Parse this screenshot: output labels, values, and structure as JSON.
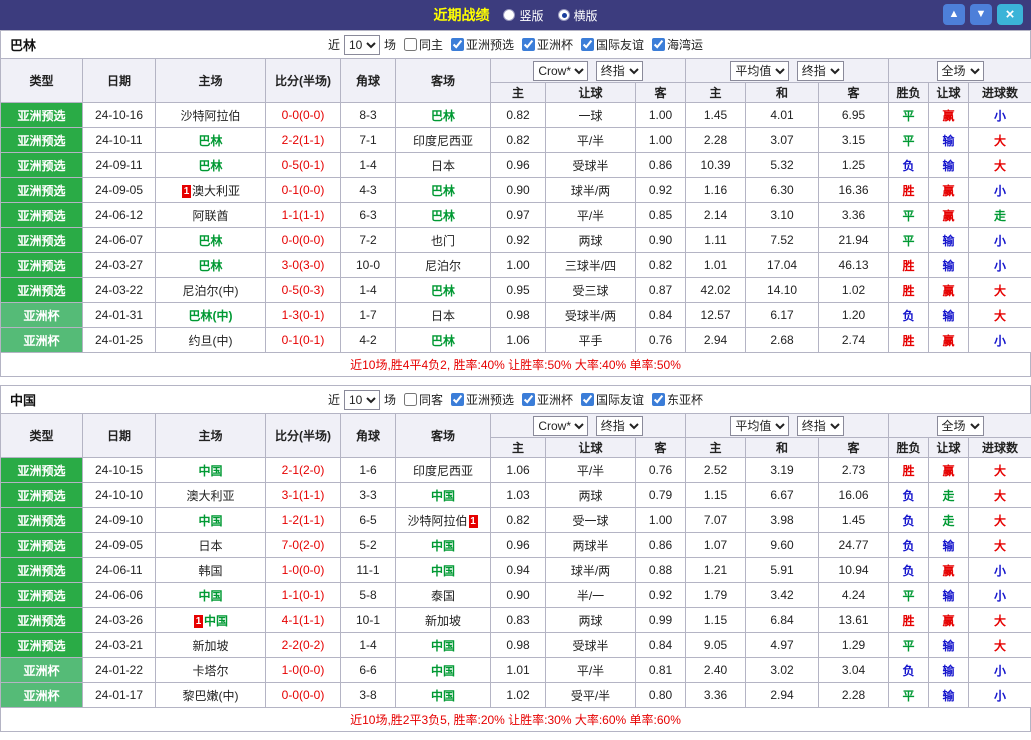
{
  "palette": {
    "titlebar_bg": "#3c3c7e",
    "title_color": "#ffff00",
    "scroll_btn": "#4d7fd9",
    "close_btn": "#3bb4d8",
    "red": "#e60000",
    "blue": "#1414cc",
    "green": "#009933",
    "type_pre": "#2aab46",
    "type_cup": "#55bb77",
    "header_bg": "#f0f0f7",
    "odds_col_bg": "#fdf5f0",
    "border": "#b4b4c4"
  },
  "titlebar": {
    "title": "近期战绩",
    "radios": [
      {
        "label": "竖版",
        "selected": false
      },
      {
        "label": "横版",
        "selected": true
      }
    ],
    "up_icon": "▲",
    "down_icon": "▼",
    "close_icon": "×"
  },
  "table_header": {
    "cols": [
      "类型",
      "日期",
      "主场",
      "比分(半场)",
      "角球",
      "客场"
    ],
    "dropdown_odds_source": "Crow*",
    "dropdown_odds_time": "终指",
    "dropdown_avg_source": "平均值",
    "dropdown_avg_time": "终指",
    "dropdown_scope": "全场",
    "odds_subcols": [
      "主",
      "让球",
      "客"
    ],
    "avg_subcols": [
      "主",
      "和",
      "客"
    ],
    "result_subcols": [
      "胜负",
      "让球",
      "进球数"
    ]
  },
  "sections": [
    {
      "team": "巴林",
      "filter": {
        "prefix": "近",
        "count": "10",
        "suffix": "场",
        "same_side": {
          "label": "同主",
          "checked": false
        },
        "competitions": [
          {
            "label": "亚洲预选",
            "checked": true
          },
          {
            "label": "亚洲杯",
            "checked": true
          },
          {
            "label": "国际友谊",
            "checked": true
          },
          {
            "label": "海湾运",
            "checked": true
          }
        ]
      },
      "rows": [
        {
          "type": "亚洲预选",
          "date": "24-10-16",
          "home": {
            "name": "沙特阿拉伯",
            "green": false
          },
          "score": "0-0(0-0)",
          "corners": "8-3",
          "away": {
            "name": "巴林",
            "green": true
          },
          "odds": [
            "0.82",
            "一球",
            "1.00"
          ],
          "avg": [
            "1.45",
            "4.01",
            "6.95"
          ],
          "result": {
            "text": "平",
            "color": "green"
          },
          "let": {
            "text": "赢",
            "color": "red"
          },
          "goals": {
            "text": "小",
            "color": "blue"
          }
        },
        {
          "type": "亚洲预选",
          "date": "24-10-11",
          "home": {
            "name": "巴林",
            "green": true
          },
          "score": "2-2(1-1)",
          "corners": "7-1",
          "away": {
            "name": "印度尼西亚",
            "green": false
          },
          "odds": [
            "0.82",
            "平/半",
            "1.00"
          ],
          "avg": [
            "2.28",
            "3.07",
            "3.15"
          ],
          "result": {
            "text": "平",
            "color": "green"
          },
          "let": {
            "text": "输",
            "color": "blue"
          },
          "goals": {
            "text": "大",
            "color": "red"
          }
        },
        {
          "type": "亚洲预选",
          "date": "24-09-11",
          "home": {
            "name": "巴林",
            "green": true
          },
          "score": "0-5(0-1)",
          "corners": "1-4",
          "away": {
            "name": "日本",
            "green": false
          },
          "odds": [
            "0.96",
            "受球半",
            "0.86"
          ],
          "avg": [
            "10.39",
            "5.32",
            "1.25"
          ],
          "result": {
            "text": "负",
            "color": "blue"
          },
          "let": {
            "text": "输",
            "color": "blue"
          },
          "goals": {
            "text": "大",
            "color": "red"
          }
        },
        {
          "type": "亚洲预选",
          "date": "24-09-05",
          "home": {
            "name": "澳大利亚",
            "green": false,
            "red_card": "1",
            "red_card_pos": "before"
          },
          "score": "0-1(0-0)",
          "corners": "4-3",
          "away": {
            "name": "巴林",
            "green": true
          },
          "odds": [
            "0.90",
            "球半/两",
            "0.92"
          ],
          "avg": [
            "1.16",
            "6.30",
            "16.36"
          ],
          "result": {
            "text": "胜",
            "color": "red"
          },
          "let": {
            "text": "赢",
            "color": "red"
          },
          "goals": {
            "text": "小",
            "color": "blue"
          }
        },
        {
          "type": "亚洲预选",
          "date": "24-06-12",
          "home": {
            "name": "阿联酋",
            "green": false
          },
          "score": "1-1(1-1)",
          "corners": "6-3",
          "away": {
            "name": "巴林",
            "green": true
          },
          "odds": [
            "0.97",
            "平/半",
            "0.85"
          ],
          "avg": [
            "2.14",
            "3.10",
            "3.36"
          ],
          "result": {
            "text": "平",
            "color": "green"
          },
          "let": {
            "text": "赢",
            "color": "red"
          },
          "goals": {
            "text": "走",
            "color": "green"
          }
        },
        {
          "type": "亚洲预选",
          "date": "24-06-07",
          "home": {
            "name": "巴林",
            "green": true
          },
          "score": "0-0(0-0)",
          "corners": "7-2",
          "away": {
            "name": "也门",
            "green": false
          },
          "odds": [
            "0.92",
            "两球",
            "0.90"
          ],
          "avg": [
            "1.11",
            "7.52",
            "21.94"
          ],
          "result": {
            "text": "平",
            "color": "green"
          },
          "let": {
            "text": "输",
            "color": "blue"
          },
          "goals": {
            "text": "小",
            "color": "blue"
          }
        },
        {
          "type": "亚洲预选",
          "date": "24-03-27",
          "home": {
            "name": "巴林",
            "green": true
          },
          "score": "3-0(3-0)",
          "corners": "10-0",
          "away": {
            "name": "尼泊尔",
            "green": false
          },
          "odds": [
            "1.00",
            "三球半/四",
            "0.82"
          ],
          "avg": [
            "1.01",
            "17.04",
            "46.13"
          ],
          "result": {
            "text": "胜",
            "color": "red"
          },
          "let": {
            "text": "输",
            "color": "blue"
          },
          "goals": {
            "text": "小",
            "color": "blue"
          }
        },
        {
          "type": "亚洲预选",
          "date": "24-03-22",
          "home": {
            "name": "尼泊尔(中)",
            "green": false
          },
          "score": "0-5(0-3)",
          "corners": "1-4",
          "away": {
            "name": "巴林",
            "green": true
          },
          "odds": [
            "0.95",
            "受三球",
            "0.87"
          ],
          "avg": [
            "42.02",
            "14.10",
            "1.02"
          ],
          "result": {
            "text": "胜",
            "color": "red"
          },
          "let": {
            "text": "赢",
            "color": "red"
          },
          "goals": {
            "text": "大",
            "color": "red"
          }
        },
        {
          "type": "亚洲杯",
          "date": "24-01-31",
          "home": {
            "name": "巴林(中)",
            "green": true
          },
          "score": "1-3(0-1)",
          "corners": "1-7",
          "away": {
            "name": "日本",
            "green": false
          },
          "odds": [
            "0.98",
            "受球半/两",
            "0.84"
          ],
          "avg": [
            "12.57",
            "6.17",
            "1.20"
          ],
          "result": {
            "text": "负",
            "color": "blue"
          },
          "let": {
            "text": "输",
            "color": "blue"
          },
          "goals": {
            "text": "大",
            "color": "red"
          }
        },
        {
          "type": "亚洲杯",
          "date": "24-01-25",
          "home": {
            "name": "约旦(中)",
            "green": false
          },
          "score": "0-1(0-1)",
          "corners": "4-2",
          "away": {
            "name": "巴林",
            "green": true
          },
          "odds": [
            "1.06",
            "平手",
            "0.76"
          ],
          "avg": [
            "2.94",
            "2.68",
            "2.74"
          ],
          "result": {
            "text": "胜",
            "color": "red"
          },
          "let": {
            "text": "赢",
            "color": "red"
          },
          "goals": {
            "text": "小",
            "color": "blue"
          }
        }
      ],
      "summary": "近10场,胜4平4负2, 胜率:40% 让胜率:50% 大率:40% 单率:50%"
    },
    {
      "team": "中国",
      "filter": {
        "prefix": "近",
        "count": "10",
        "suffix": "场",
        "same_side": {
          "label": "同客",
          "checked": false
        },
        "competitions": [
          {
            "label": "亚洲预选",
            "checked": true
          },
          {
            "label": "亚洲杯",
            "checked": true
          },
          {
            "label": "国际友谊",
            "checked": true
          },
          {
            "label": "东亚杯",
            "checked": true
          }
        ]
      },
      "rows": [
        {
          "type": "亚洲预选",
          "date": "24-10-15",
          "home": {
            "name": "中国",
            "green": true
          },
          "score": "2-1(2-0)",
          "corners": "1-6",
          "away": {
            "name": "印度尼西亚",
            "green": false
          },
          "odds": [
            "1.06",
            "平/半",
            "0.76"
          ],
          "avg": [
            "2.52",
            "3.19",
            "2.73"
          ],
          "result": {
            "text": "胜",
            "color": "red"
          },
          "let": {
            "text": "赢",
            "color": "red"
          },
          "goals": {
            "text": "大",
            "color": "red"
          }
        },
        {
          "type": "亚洲预选",
          "date": "24-10-10",
          "home": {
            "name": "澳大利亚",
            "green": false
          },
          "score": "3-1(1-1)",
          "corners": "3-3",
          "away": {
            "name": "中国",
            "green": true
          },
          "odds": [
            "1.03",
            "两球",
            "0.79"
          ],
          "avg": [
            "1.15",
            "6.67",
            "16.06"
          ],
          "result": {
            "text": "负",
            "color": "blue"
          },
          "let": {
            "text": "走",
            "color": "green"
          },
          "goals": {
            "text": "大",
            "color": "red"
          }
        },
        {
          "type": "亚洲预选",
          "date": "24-09-10",
          "home": {
            "name": "中国",
            "green": true
          },
          "score": "1-2(1-1)",
          "corners": "6-5",
          "away": {
            "name": "沙特阿拉伯",
            "green": false,
            "red_card": "1",
            "red_card_pos": "after"
          },
          "odds": [
            "0.82",
            "受一球",
            "1.00"
          ],
          "avg": [
            "7.07",
            "3.98",
            "1.45"
          ],
          "result": {
            "text": "负",
            "color": "blue"
          },
          "let": {
            "text": "走",
            "color": "green"
          },
          "goals": {
            "text": "大",
            "color": "red"
          }
        },
        {
          "type": "亚洲预选",
          "date": "24-09-05",
          "home": {
            "name": "日本",
            "green": false
          },
          "score": "7-0(2-0)",
          "corners": "5-2",
          "away": {
            "name": "中国",
            "green": true
          },
          "odds": [
            "0.96",
            "两球半",
            "0.86"
          ],
          "avg": [
            "1.07",
            "9.60",
            "24.77"
          ],
          "result": {
            "text": "负",
            "color": "blue"
          },
          "let": {
            "text": "输",
            "color": "blue"
          },
          "goals": {
            "text": "大",
            "color": "red"
          }
        },
        {
          "type": "亚洲预选",
          "date": "24-06-11",
          "home": {
            "name": "韩国",
            "green": false
          },
          "score": "1-0(0-0)",
          "corners": "11-1",
          "away": {
            "name": "中国",
            "green": true
          },
          "odds": [
            "0.94",
            "球半/两",
            "0.88"
          ],
          "avg": [
            "1.21",
            "5.91",
            "10.94"
          ],
          "result": {
            "text": "负",
            "color": "blue"
          },
          "let": {
            "text": "赢",
            "color": "red"
          },
          "goals": {
            "text": "小",
            "color": "blue"
          }
        },
        {
          "type": "亚洲预选",
          "date": "24-06-06",
          "home": {
            "name": "中国",
            "green": true
          },
          "score": "1-1(0-1)",
          "corners": "5-8",
          "away": {
            "name": "泰国",
            "green": false
          },
          "odds": [
            "0.90",
            "半/一",
            "0.92"
          ],
          "avg": [
            "1.79",
            "3.42",
            "4.24"
          ],
          "result": {
            "text": "平",
            "color": "green"
          },
          "let": {
            "text": "输",
            "color": "blue"
          },
          "goals": {
            "text": "小",
            "color": "blue"
          }
        },
        {
          "type": "亚洲预选",
          "date": "24-03-26",
          "home": {
            "name": "中国",
            "green": true,
            "red_card": "1",
            "red_card_pos": "before"
          },
          "score": "4-1(1-1)",
          "corners": "10-1",
          "away": {
            "name": "新加坡",
            "green": false
          },
          "odds": [
            "0.83",
            "两球",
            "0.99"
          ],
          "avg": [
            "1.15",
            "6.84",
            "13.61"
          ],
          "result": {
            "text": "胜",
            "color": "red"
          },
          "let": {
            "text": "赢",
            "color": "red"
          },
          "goals": {
            "text": "大",
            "color": "red"
          }
        },
        {
          "type": "亚洲预选",
          "date": "24-03-21",
          "home": {
            "name": "新加坡",
            "green": false
          },
          "score": "2-2(0-2)",
          "corners": "1-4",
          "away": {
            "name": "中国",
            "green": true
          },
          "odds": [
            "0.98",
            "受球半",
            "0.84"
          ],
          "avg": [
            "9.05",
            "4.97",
            "1.29"
          ],
          "result": {
            "text": "平",
            "color": "green"
          },
          "let": {
            "text": "输",
            "color": "blue"
          },
          "goals": {
            "text": "大",
            "color": "red"
          }
        },
        {
          "type": "亚洲杯",
          "date": "24-01-22",
          "home": {
            "name": "卡塔尔",
            "green": false
          },
          "score": "1-0(0-0)",
          "corners": "6-6",
          "away": {
            "name": "中国",
            "green": true
          },
          "odds": [
            "1.01",
            "平/半",
            "0.81"
          ],
          "avg": [
            "2.40",
            "3.02",
            "3.04"
          ],
          "result": {
            "text": "负",
            "color": "blue"
          },
          "let": {
            "text": "输",
            "color": "blue"
          },
          "goals": {
            "text": "小",
            "color": "blue"
          }
        },
        {
          "type": "亚洲杯",
          "date": "24-01-17",
          "home": {
            "name": "黎巴嫩(中)",
            "green": false
          },
          "score": "0-0(0-0)",
          "corners": "3-8",
          "away": {
            "name": "中国",
            "green": true
          },
          "odds": [
            "1.02",
            "受平/半",
            "0.80"
          ],
          "avg": [
            "3.36",
            "2.94",
            "2.28"
          ],
          "result": {
            "text": "平",
            "color": "green"
          },
          "let": {
            "text": "输",
            "color": "blue"
          },
          "goals": {
            "text": "小",
            "color": "blue"
          }
        }
      ],
      "summary": "近10场,胜2平3负5, 胜率:20% 让胜率:30% 大率:60% 单率:60%"
    }
  ]
}
